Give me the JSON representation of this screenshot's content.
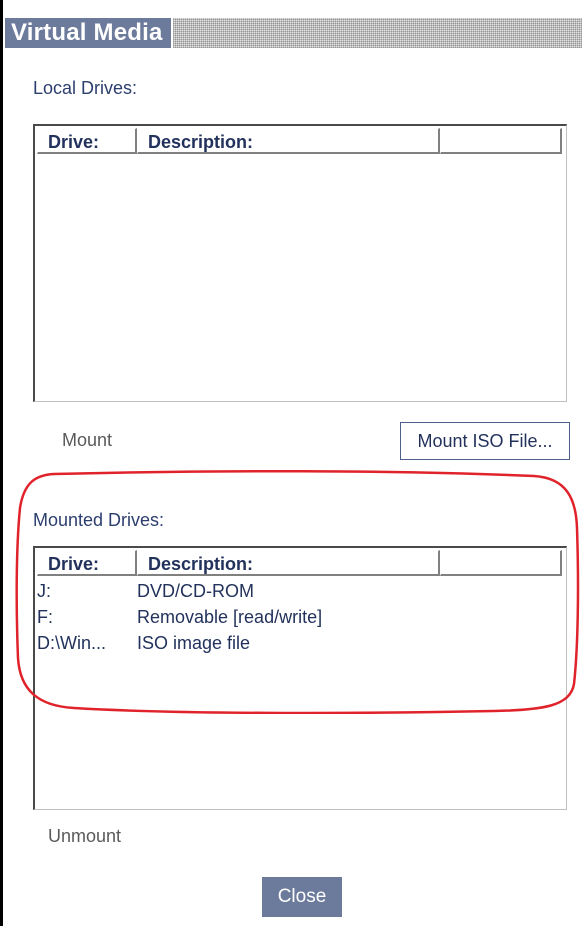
{
  "window": {
    "title": "Virtual Media"
  },
  "local_drives": {
    "label": "Local Drives:",
    "columns": [
      "Drive:",
      "Description:",
      ""
    ],
    "rows": [],
    "mount_label": "Mount",
    "mount_iso_label": "Mount ISO File..."
  },
  "mounted_drives": {
    "label": "Mounted Drives:",
    "columns": [
      "Drive:",
      "Description:",
      ""
    ],
    "rows": [
      {
        "drive": "J:",
        "description": "DVD/CD-ROM"
      },
      {
        "drive": "F:",
        "description": "Removable [read/write]"
      },
      {
        "drive": "D:\\Win...",
        "description": "ISO image file"
      }
    ],
    "unmount_label": "Unmount"
  },
  "footer": {
    "close_label": "Close"
  },
  "colors": {
    "title_bg": "#6c7b9c",
    "text": "#22325c",
    "highlight": "#e0232a"
  }
}
